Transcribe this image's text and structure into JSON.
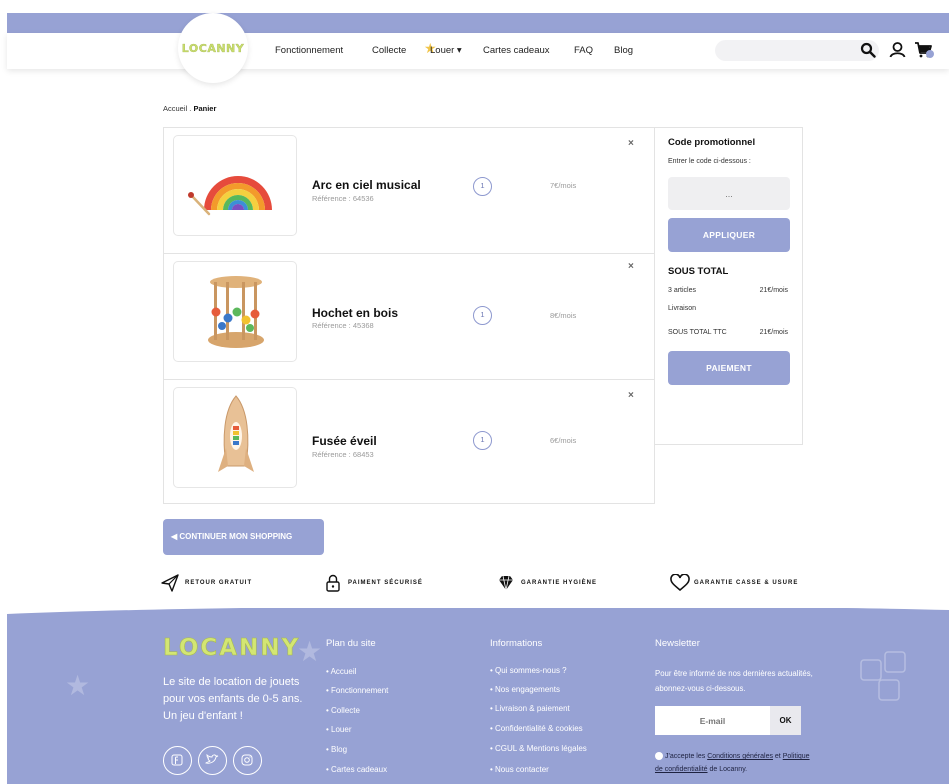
{
  "header": {
    "logo": "LOCANNY",
    "nav": [
      "Fonctionnement",
      "Collecte",
      "Louer ▾",
      "Cartes cadeaux",
      "FAQ",
      "Blog"
    ],
    "icons": [
      "search-icon",
      "user-icon",
      "cart-icon"
    ]
  },
  "breadcrumb": {
    "home": "Accueil",
    "separator": ".",
    "current": "Panier"
  },
  "cart": {
    "items": [
      {
        "name": "Arc en ciel musical",
        "reference": "Référence : 64536",
        "qty": "1",
        "price": "7€/mois",
        "remove": "×"
      },
      {
        "name": "Hochet en bois",
        "reference": "Référence : 45368",
        "qty": "1",
        "price": "8€/mois",
        "remove": "×"
      },
      {
        "name": "Fusée éveil",
        "reference": "Référence : 68453",
        "qty": "1",
        "price": "6€/mois",
        "remove": "×"
      }
    ]
  },
  "summary": {
    "promo_title": "Code promotionnel",
    "promo_hint": "Entrer le code ci-dessous :",
    "promo_placeholder": "...",
    "apply_label": "APPLIQUER",
    "subtotal_title": "SOUS TOTAL",
    "articles_label": "3 articles",
    "articles_value": "21€/mois",
    "delivery_label": "Livraison",
    "ttc_label": "SOUS TOTAL TTC",
    "ttc_value": "21€/mois",
    "pay_label": "PAIEMENT"
  },
  "continue_label": "◀  CONTINUER MON SHOPPING",
  "reassurance": [
    {
      "icon": "paper-plane-icon",
      "label": "RETOUR GRATUIT"
    },
    {
      "icon": "lock-icon",
      "label": "PAIMENT SÉCURISÉ"
    },
    {
      "icon": "diamond-icon",
      "label": "GARANTIE HYGIÈNE"
    },
    {
      "icon": "heart-icon",
      "label": "GARANTIE CASSE & USURE"
    }
  ],
  "footer": {
    "logo": "LOCANNY",
    "tagline": "Le site de location de jouets pour vos enfants de 0-5 ans. Un jeu d'enfant !",
    "social": [
      "facebook-icon",
      "twitter-icon",
      "instagram-icon"
    ],
    "plan_title": "Plan du site",
    "plan_links": [
      "Accueil",
      "Fonctionnement",
      "Collecte",
      "Louer",
      "Blog",
      "Cartes cadeaux"
    ],
    "info_title": "Informations",
    "info_links": [
      "Qui sommes-nous ?",
      "Nos engagements",
      "Livraison & paiement",
      "Confidentialité & cookies",
      "CGUL & Mentions légales",
      "Nous contacter"
    ],
    "newsletter_title": "Newsletter",
    "newsletter_text": "Pour être informé de nos dernières actualités, abonnez-vous ci-dessous.",
    "newsletter_placeholder": "E-mail",
    "newsletter_button": "OK",
    "consent_prefix": "J'accepte les ",
    "consent_cgu": "Conditions générales",
    "consent_mid": " et ",
    "consent_privacy": "Politique de confidentialité",
    "consent_suffix": " de Locanny."
  },
  "colors": {
    "accent": "#97a2d4",
    "logo_green": "#d3e673",
    "white": "#ffffff"
  }
}
